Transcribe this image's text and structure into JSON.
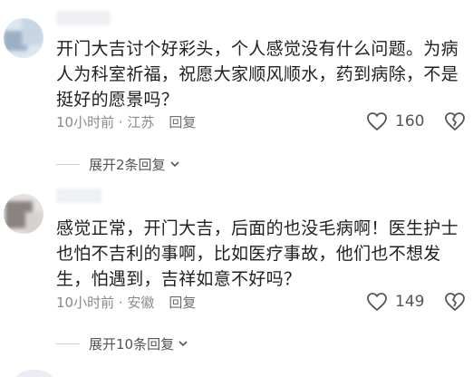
{
  "comments": [
    {
      "text": "开门大吉讨个好彩头，个人感觉没有什么问题。为病人为科室祈福，祝愿大家顺风顺水，药到病除，不是挺好的愿景吗？",
      "time_location": "10小时前 · 江苏",
      "reply_label": "回复",
      "like_count": "160",
      "expand_label": "展开2条回复"
    },
    {
      "text": "感觉正常，开门大吉，后面的也没毛病啊！医生护士也怕不吉利的事啊，比如医疗事故，他们也不想发生，怕遇到，吉祥如意不好吗？",
      "time_location": "10小时前 · 安徽",
      "reply_label": "回复",
      "like_count": "149",
      "expand_label": "展开10条回复"
    }
  ],
  "icons": {
    "like": "heart-icon",
    "dislike": "broken-heart-icon",
    "expand": "chevron-down-icon"
  }
}
